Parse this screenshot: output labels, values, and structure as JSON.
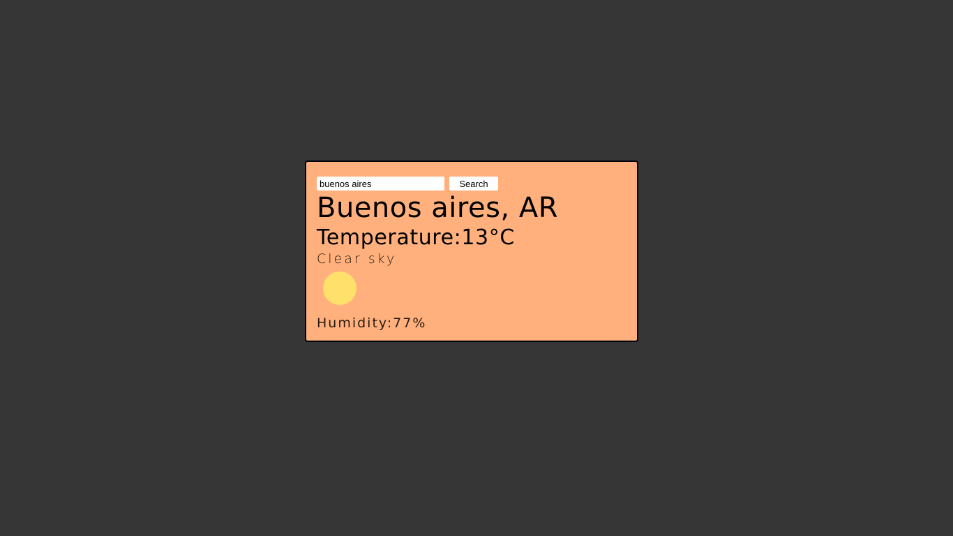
{
  "colors": {
    "page_background": "#363636",
    "card_background": "#ffb07c",
    "sun": "#ffe06a"
  },
  "search": {
    "value": "buenos aires",
    "button_label": "Search"
  },
  "weather": {
    "city": "Buenos aires, AR",
    "temperature": "Temperature:13°C",
    "description": "Clear sky",
    "icon": "sun-icon",
    "humidity": "Humidity:77%"
  }
}
